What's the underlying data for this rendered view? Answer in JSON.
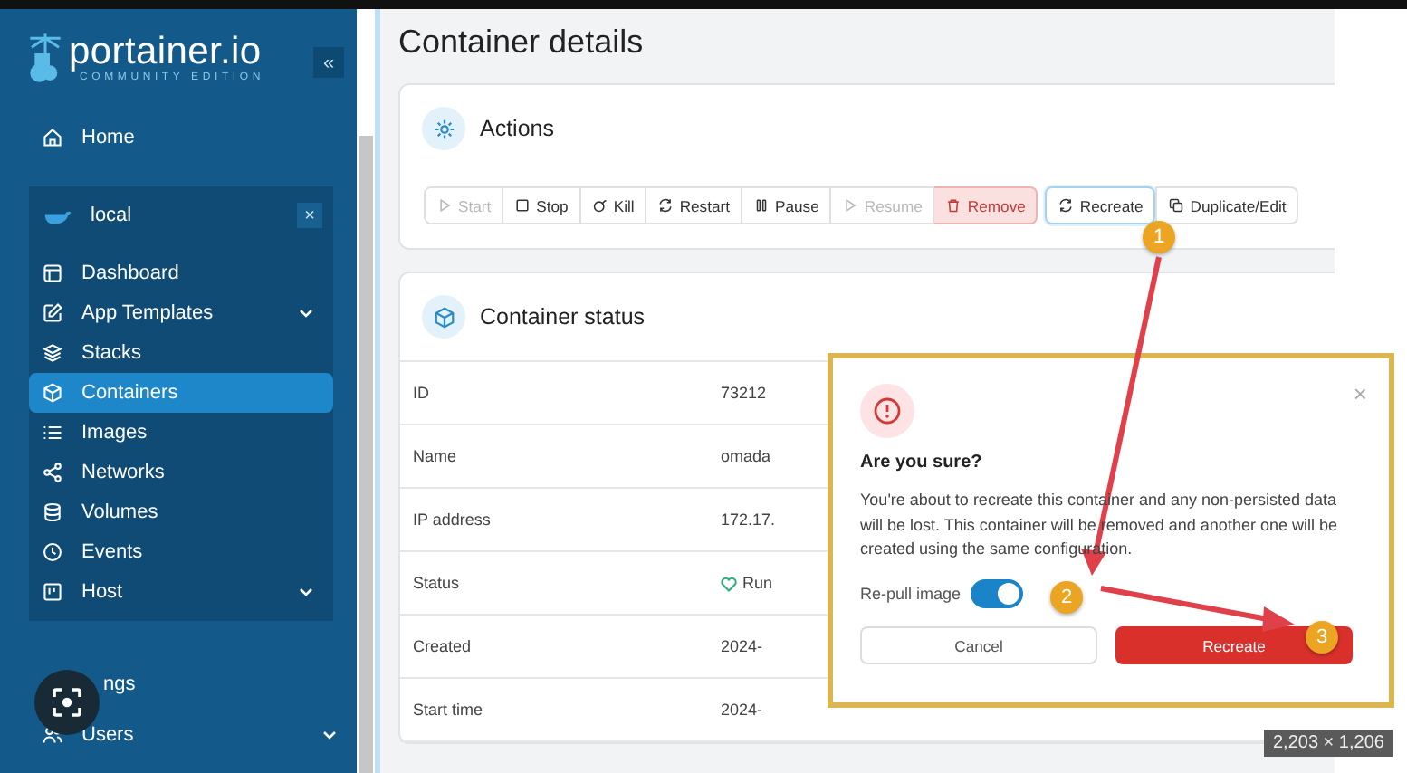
{
  "sidebar": {
    "logo": {
      "name": "portainer.io",
      "edition": "COMMUNITY EDITION"
    },
    "collapse": "«",
    "home": "Home",
    "environment": {
      "name": "local",
      "close": "×",
      "items": [
        {
          "label": "Dashboard",
          "expandable": false,
          "selected": false
        },
        {
          "label": "App Templates",
          "expandable": true,
          "selected": false
        },
        {
          "label": "Stacks",
          "expandable": false,
          "selected": false
        },
        {
          "label": "Containers",
          "expandable": false,
          "selected": true
        },
        {
          "label": "Images",
          "expandable": false,
          "selected": false
        },
        {
          "label": "Networks",
          "expandable": false,
          "selected": false
        },
        {
          "label": "Volumes",
          "expandable": false,
          "selected": false
        },
        {
          "label": "Events",
          "expandable": false,
          "selected": false
        },
        {
          "label": "Host",
          "expandable": true,
          "selected": false
        }
      ]
    },
    "bottom_items": [
      {
        "label": "ngs",
        "expandable": false
      },
      {
        "label": "Users",
        "expandable": true
      }
    ]
  },
  "page": {
    "title": "Container details"
  },
  "actions": {
    "title": "Actions",
    "buttons": [
      {
        "label": "Start",
        "kind": "default",
        "disabled": true,
        "focused": false
      },
      {
        "label": "Stop",
        "kind": "default",
        "disabled": false,
        "focused": false
      },
      {
        "label": "Kill",
        "kind": "default",
        "disabled": false,
        "focused": false
      },
      {
        "label": "Restart",
        "kind": "default",
        "disabled": false,
        "focused": false
      },
      {
        "label": "Pause",
        "kind": "default",
        "disabled": false,
        "focused": false
      },
      {
        "label": "Resume",
        "kind": "default",
        "disabled": true,
        "focused": false
      },
      {
        "label": "Remove",
        "kind": "danger",
        "disabled": false,
        "focused": false
      },
      {
        "label": "Recreate",
        "kind": "default",
        "disabled": false,
        "focused": true
      },
      {
        "label": "Duplicate/Edit",
        "kind": "default",
        "disabled": false,
        "focused": false
      }
    ]
  },
  "status": {
    "title": "Container status",
    "rows": [
      {
        "label": "ID",
        "value": "73212",
        "kind": "text"
      },
      {
        "label": "Name",
        "value": "omada",
        "kind": "text"
      },
      {
        "label": "IP address",
        "value": "172.17.",
        "kind": "text"
      },
      {
        "label": "Status",
        "value": "Run",
        "kind": "health"
      },
      {
        "label": "Created",
        "value": "2024-",
        "kind": "text"
      },
      {
        "label": "Start time",
        "value": "2024-",
        "kind": "text"
      }
    ]
  },
  "dialog": {
    "close": "×",
    "title": "Are you sure?",
    "message": "You're about to recreate this container and any non-persisted data will be lost. This container will be removed and another one will be created using the same configuration.",
    "toggle": {
      "label": "Re-pull image",
      "on": true
    },
    "buttons": [
      {
        "label": "Cancel",
        "kind": "secondary"
      },
      {
        "label": "Recreate",
        "kind": "danger"
      }
    ]
  },
  "annotations": [
    {
      "number": "1"
    },
    {
      "number": "2"
    },
    {
      "number": "3"
    }
  ],
  "image_size": "2,203 × 1,206"
}
